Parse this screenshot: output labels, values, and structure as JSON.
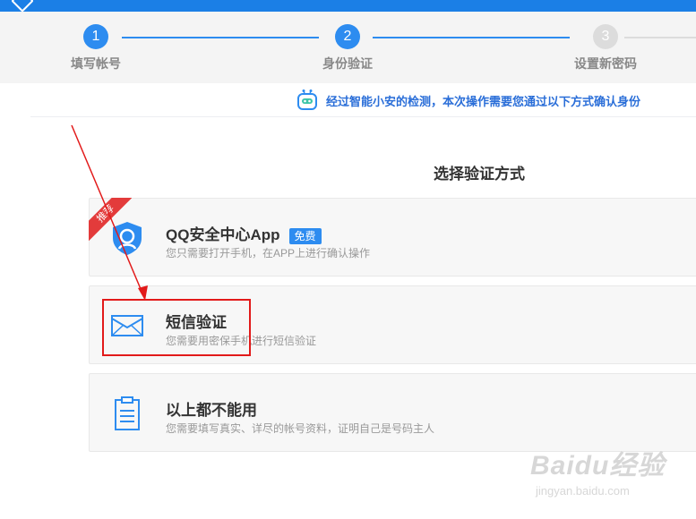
{
  "steps": [
    {
      "num": "1",
      "label": "填写帐号",
      "state": "done"
    },
    {
      "num": "2",
      "label": "身份验证",
      "state": "current"
    },
    {
      "num": "3",
      "label": "设置新密码",
      "state": "pending"
    }
  ],
  "notice": {
    "text": "经过智能小安的检测，本次操作需要您通过以下方式确认身份",
    "icon": "robot-icon"
  },
  "heading": "选择验证方式",
  "options": [
    {
      "title": "QQ安全中心App",
      "badge": "免费",
      "ribbon": "推荐",
      "desc": "您只需要打开手机，在APP上进行确认操作",
      "icon": "shield-icon"
    },
    {
      "title": "短信验证",
      "desc": "您需要用密保手机进行短信验证",
      "icon": "envelope-icon",
      "highlighted": true
    },
    {
      "title": "以上都不能用",
      "desc": "您需要填写真实、详尽的帐号资料，证明自己是号码主人",
      "icon": "clipboard-icon"
    }
  ],
  "watermark": {
    "brand": "Baidu经验",
    "url": "jingyan.baidu.com"
  },
  "colors": {
    "accent": "#2d8cf0",
    "topbar": "#1b7fe6",
    "ribbon": "#e33b3b",
    "annotation": "#e21a1a",
    "inactive": "#dcdcdc"
  }
}
